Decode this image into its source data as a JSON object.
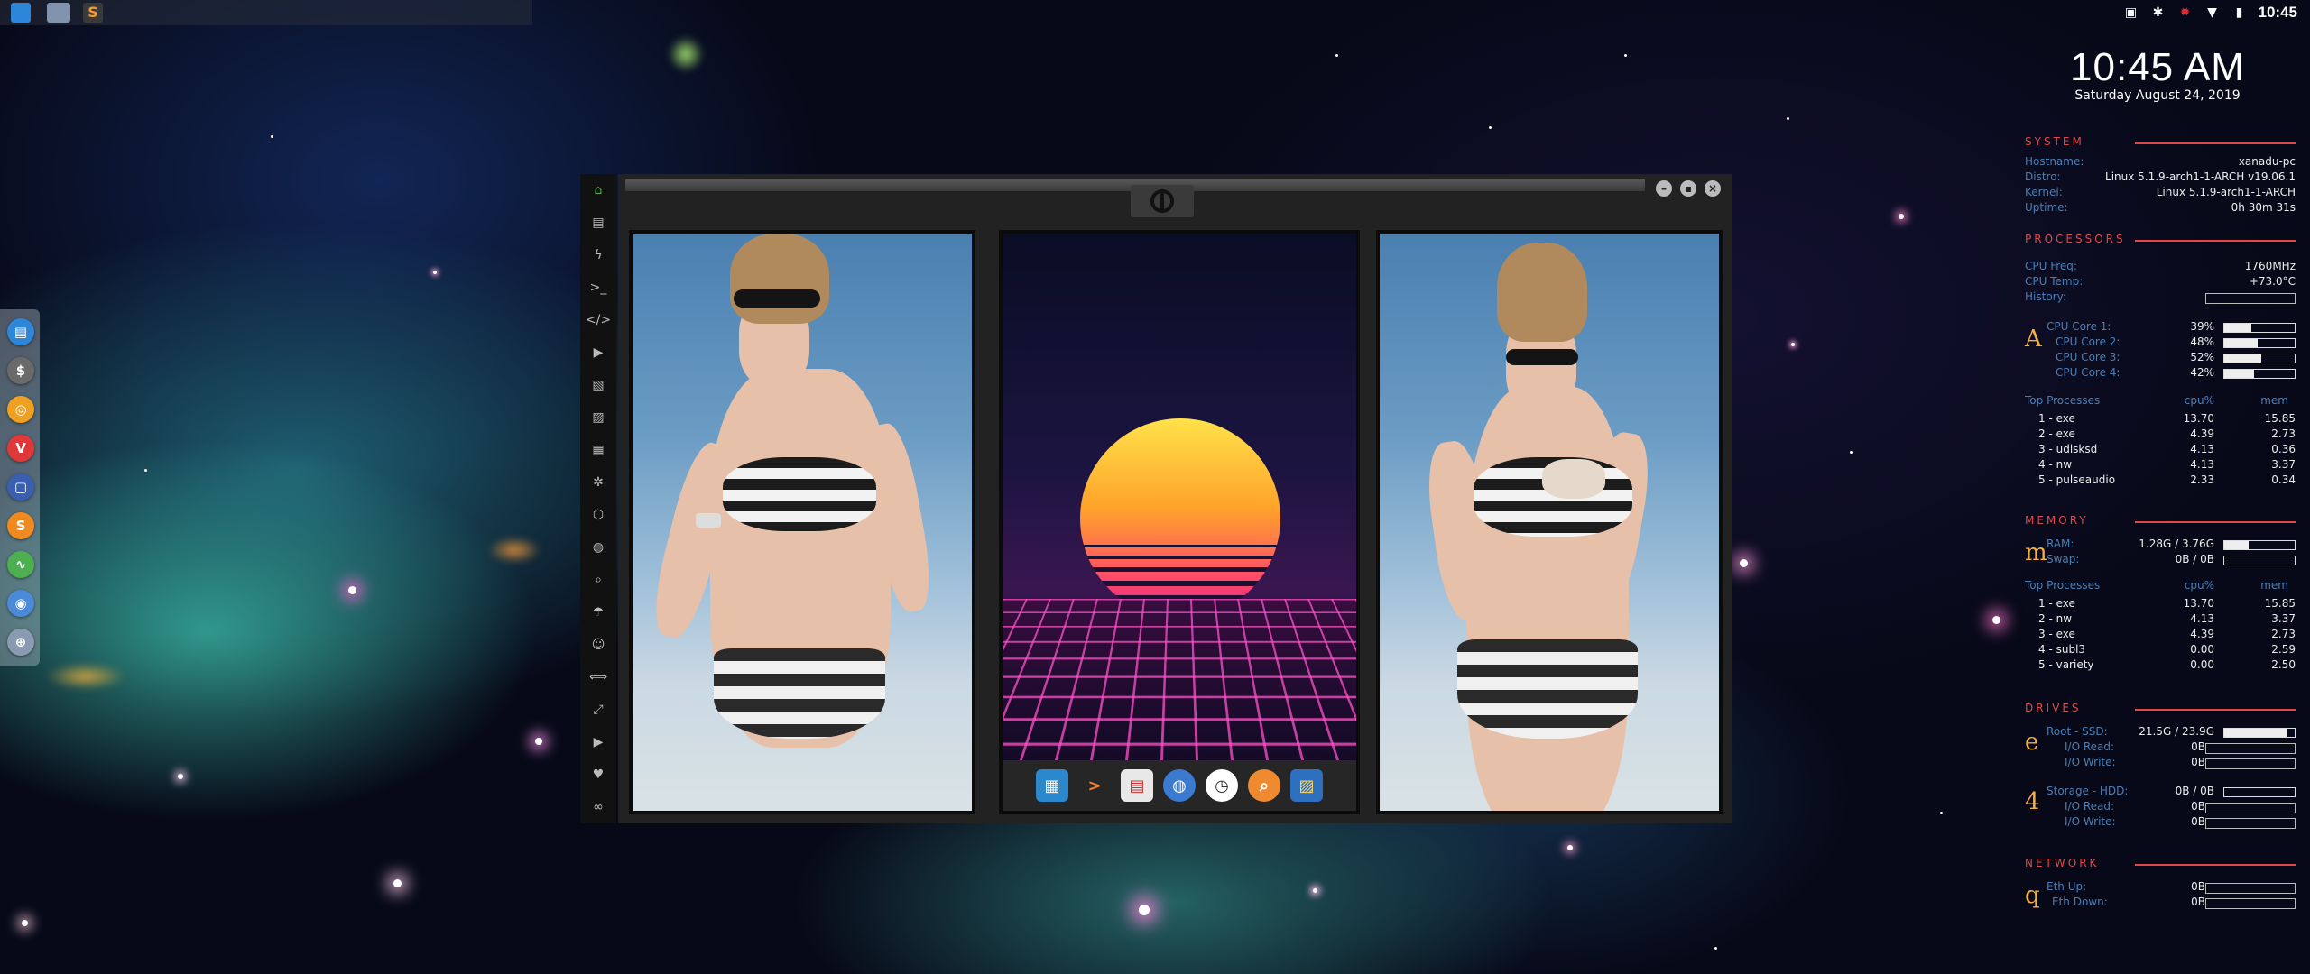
{
  "tray": {
    "time": "10:45"
  },
  "conky": {
    "clock": "10:45 AM",
    "date": "Saturday August 24, 2019",
    "system": {
      "title": "SYSTEM",
      "hostname_label": "Hostname:",
      "hostname": "xanadu-pc",
      "distro_label": "Distro:",
      "distro": "Linux 5.1.9-arch1-1-ARCH v19.06.1",
      "kernel_label": "Kernel:",
      "kernel": "Linux 5.1.9-arch1-1-ARCH",
      "uptime_label": "Uptime:",
      "uptime": "0h 30m 31s"
    },
    "processors": {
      "title": "PROCESSORS",
      "freq_label": "CPU Freq:",
      "freq": "1760MHz",
      "temp_label": "CPU Temp:",
      "temp": "+73.0°C",
      "history_label": "History:",
      "glyph": "A",
      "cores": [
        {
          "label": "CPU Core 1:",
          "value": "39%",
          "pct": 39
        },
        {
          "label": "CPU Core 2:",
          "value": "48%",
          "pct": 48
        },
        {
          "label": "CPU Core 3:",
          "value": "52%",
          "pct": 52
        },
        {
          "label": "CPU Core 4:",
          "value": "42%",
          "pct": 42
        }
      ],
      "top_title": "Top Processes",
      "col_cpu": "cpu%",
      "col_mem": "mem",
      "top": [
        {
          "name": "1 - exe",
          "cpu": "13.70",
          "mem": "15.85"
        },
        {
          "name": "2 - exe",
          "cpu": "4.39",
          "mem": "2.73"
        },
        {
          "name": "3 - udisksd",
          "cpu": "4.13",
          "mem": "0.36"
        },
        {
          "name": "4 - nw",
          "cpu": "4.13",
          "mem": "3.37"
        },
        {
          "name": "5 - pulseaudio",
          "cpu": "2.33",
          "mem": "0.34"
        }
      ]
    },
    "memory": {
      "title": "MEMORY",
      "glyph": "m",
      "ram_label": "RAM:",
      "ram": "1.28G / 3.76G",
      "ram_pct": 34,
      "swap_label": "Swap:",
      "swap": "0B / 0B",
      "top_title": "Top Processes",
      "col_cpu": "cpu%",
      "col_mem": "mem",
      "top": [
        {
          "name": "1 - exe",
          "cpu": "13.70",
          "mem": "15.85"
        },
        {
          "name": "2 - nw",
          "cpu": "4.13",
          "mem": "3.37"
        },
        {
          "name": "3 - exe",
          "cpu": "4.39",
          "mem": "2.73"
        },
        {
          "name": "4 - subl3",
          "cpu": "0.00",
          "mem": "2.59"
        },
        {
          "name": "5 - variety",
          "cpu": "0.00",
          "mem": "2.50"
        }
      ]
    },
    "drives": {
      "title": "DRIVES",
      "root_glyph": "e",
      "root_label": "Root - SSD:",
      "root": "21.5G / 23.9G",
      "root_pct": 90,
      "io_read_label": "I/O Read:",
      "io_write_label": "I/O Write:",
      "root_read": "0B",
      "root_write": "0B",
      "storage_glyph": "4",
      "storage_label": "Storage - HDD:",
      "storage": "0B / 0B",
      "storage_read": "0B",
      "storage_write": "0B"
    },
    "network": {
      "title": "NETWORK",
      "glyph": "q",
      "up_label": "Eth Up:",
      "up": "0B",
      "down_label": "Eth Down:",
      "down": "0B"
    }
  },
  "colors": {
    "accent_red": "#e04848",
    "label_blue": "#4a7fb5",
    "glyph_gold": "#f5b040"
  }
}
